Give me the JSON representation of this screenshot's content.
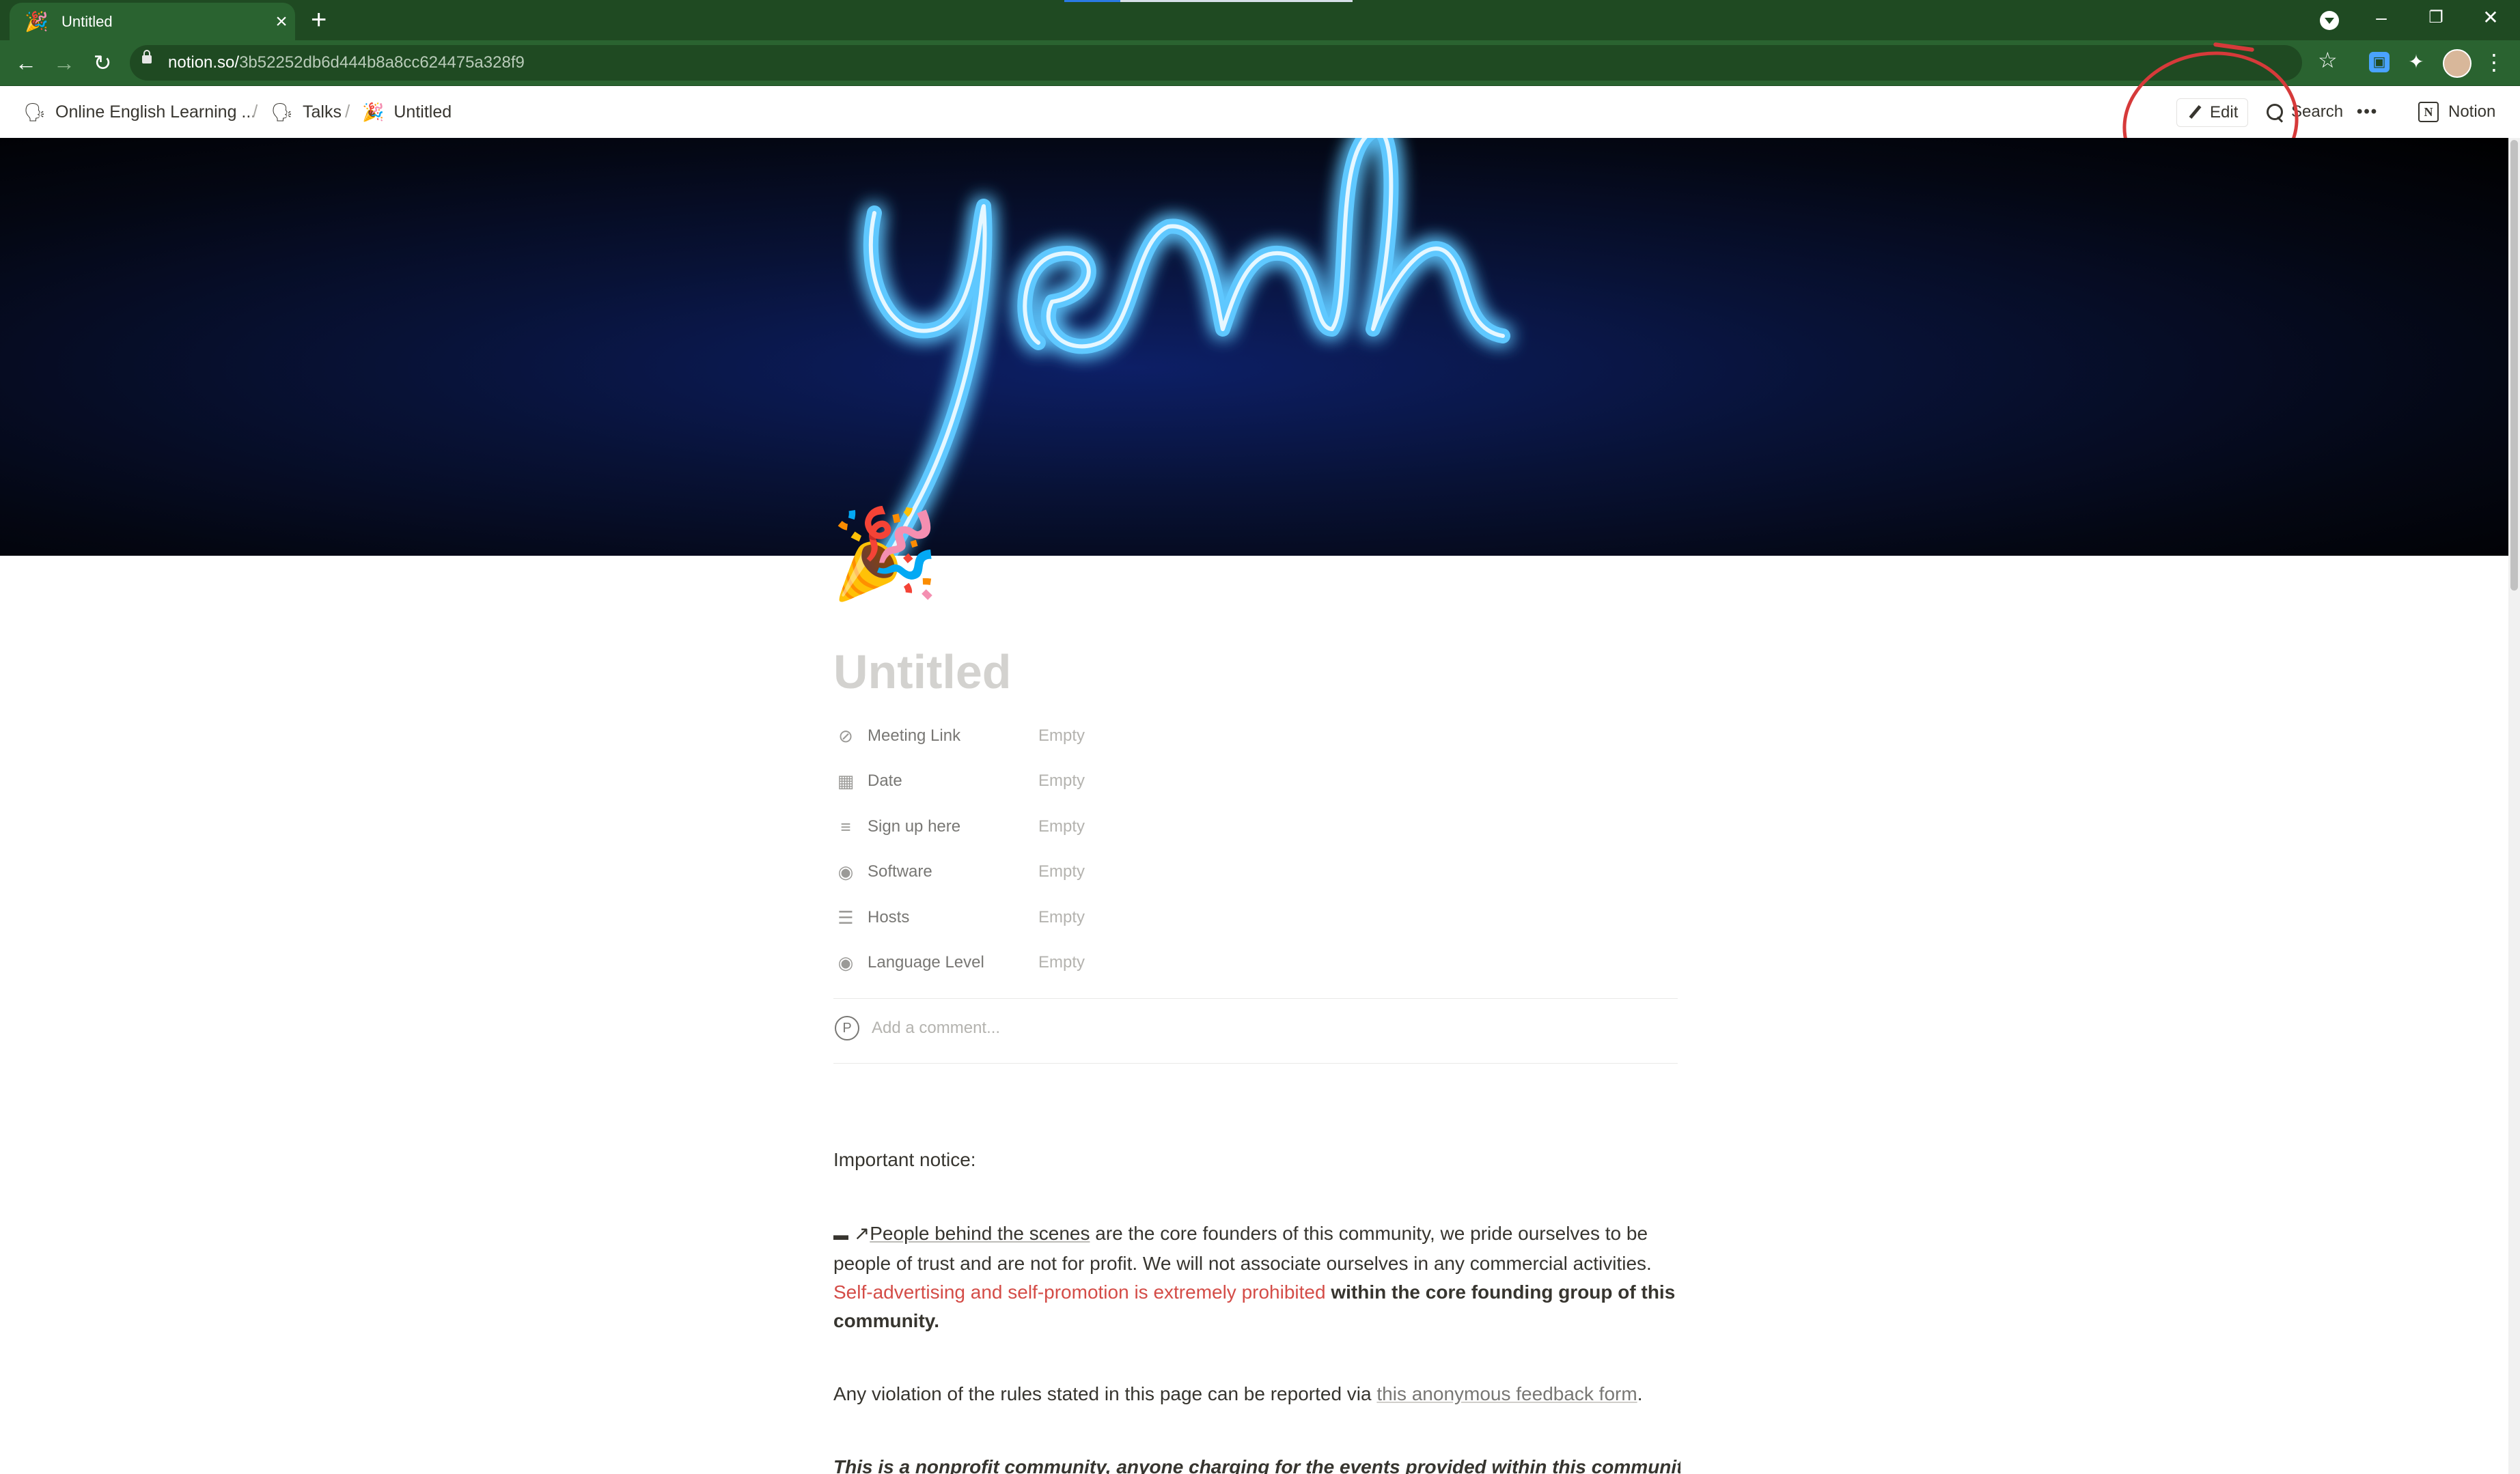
{
  "browser": {
    "tab": {
      "title": "Untitled",
      "favicon": "🎉"
    },
    "new_tab": "+",
    "url_host": "notion.so/",
    "url_path": "3b52252db6d444b8a8cc624475a328f9",
    "window_controls": {
      "minimize": "–",
      "restore": "❐",
      "close": "✕"
    }
  },
  "notion": {
    "breadcrumbs": [
      {
        "icon": "🗣",
        "label": "Online English Learning ..."
      },
      {
        "icon": "🗣",
        "label": "Talks"
      },
      {
        "icon": "🎉",
        "label": "Untitled"
      }
    ],
    "breadcrumb_separator": "/",
    "actions": {
      "edit": "Edit",
      "search": "Search",
      "more": "•••",
      "brand": "Notion"
    }
  },
  "page": {
    "icon": "🎉",
    "title": "Untitled",
    "properties": [
      {
        "icon": "link-icon",
        "glyph": "⊘",
        "name": "Meeting Link",
        "value": "Empty"
      },
      {
        "icon": "calendar-icon",
        "glyph": "▦",
        "name": "Date",
        "value": "Empty"
      },
      {
        "icon": "text-icon",
        "glyph": "≡",
        "name": "Sign up here",
        "value": "Empty"
      },
      {
        "icon": "select-icon",
        "glyph": "◉",
        "name": "Software",
        "value": "Empty"
      },
      {
        "icon": "list-icon",
        "glyph": "☰",
        "name": "Hosts",
        "value": "Empty"
      },
      {
        "icon": "select-icon",
        "glyph": "◉",
        "name": "Language Level",
        "value": "Empty"
      }
    ],
    "comment": {
      "avatar": "P",
      "placeholder": "Add a comment..."
    },
    "content": {
      "notice": "Important notice:",
      "p1_link": "People behind the scenes",
      "p1_text": " are the core founders of this community, we pride ourselves to be people of trust and are not for profit.  We will not associate ourselves in any commercial activities. ",
      "p1_red": "Self-advertising and self-promotion is extremely prohibited",
      "p1_bold": " within the core founding group of this community.",
      "p2_text": "Any violation of the rules stated in this page can be reported via ",
      "p2_link": "this anonymous feedback form",
      "p2_end": ".",
      "p3_italic": "This is a nonprofit community, anyone charging for the events provided within this community"
    }
  },
  "colors": {
    "chrome": "#2a6330",
    "accent_red": "#d44c47",
    "annotation": "#d63a3a"
  }
}
